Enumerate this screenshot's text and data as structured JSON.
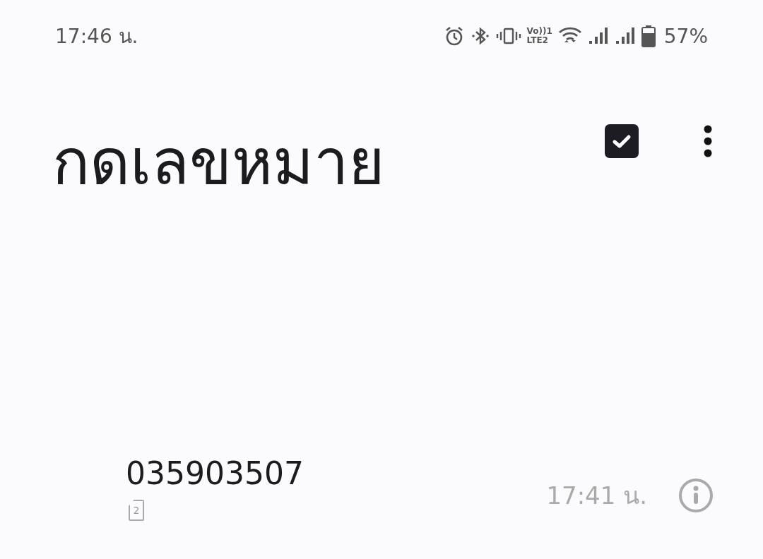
{
  "status_bar": {
    "time": "17:46 น.",
    "volte_top": "Vo))1",
    "volte_bottom": "LTE2",
    "battery": "57%"
  },
  "header": {
    "title": "กดเลขหมาย"
  },
  "calls": [
    {
      "number": "035903507",
      "sim_slot": "2",
      "time": "17:41 น."
    }
  ]
}
